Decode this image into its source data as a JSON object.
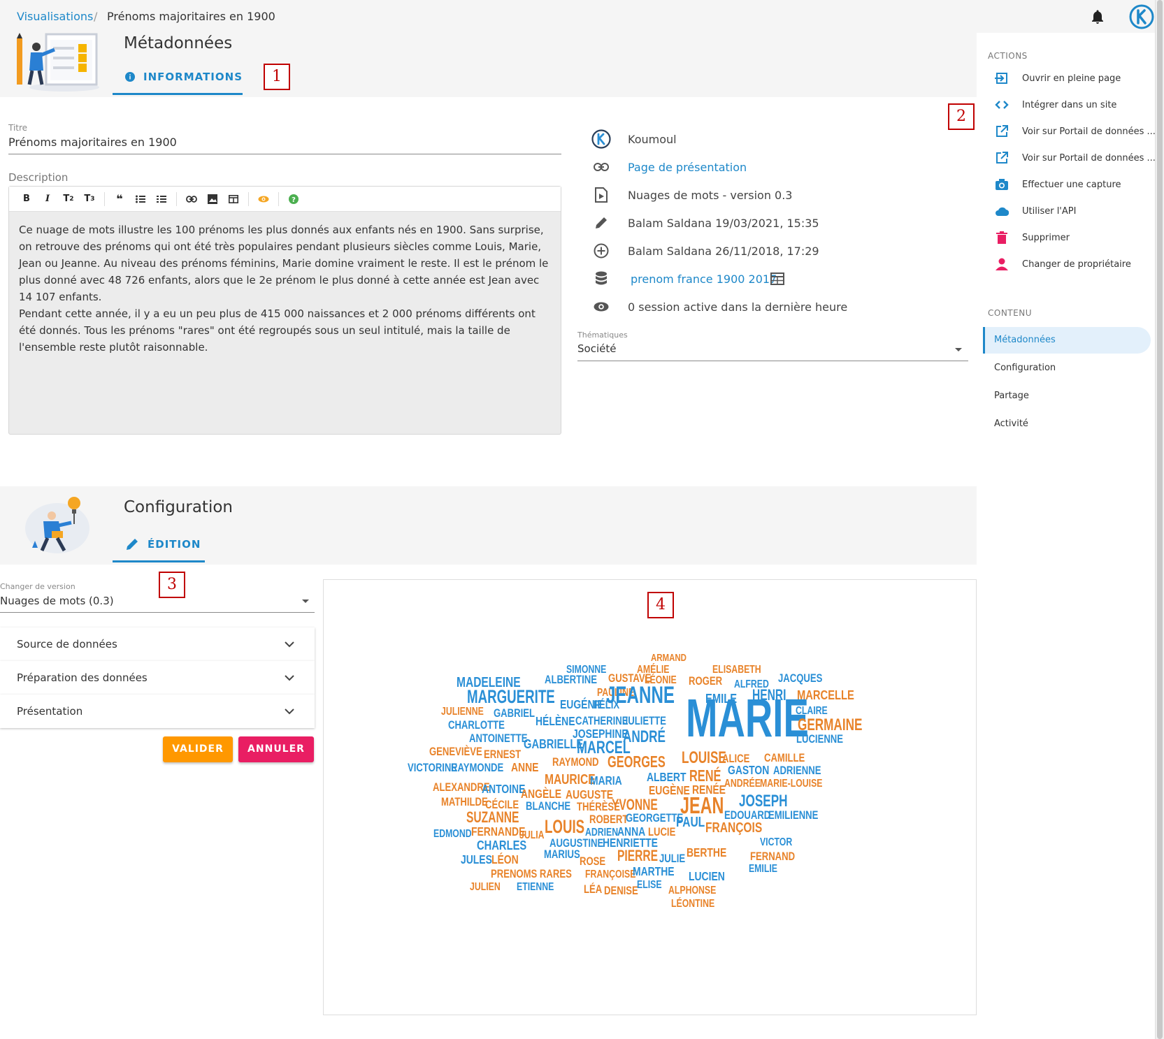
{
  "breadcrumb": {
    "parent": "Visualisations",
    "separator": "/",
    "current": "Prénoms majoritaires en 1900"
  },
  "metadata_section": {
    "title": "Métadonnées",
    "tab_label": "INFORMATIONS",
    "marker_1": "1",
    "marker_2": "2"
  },
  "form": {
    "title_label": "Titre",
    "title_value": "Prénoms majoritaires en 1900",
    "description_label": "Description",
    "toolbar": [
      "B",
      "I",
      "T2",
      "T3",
      "quote",
      "bulleted-list",
      "numbered-list",
      "link",
      "image",
      "table",
      "preview",
      "help"
    ],
    "description_p1": "Ce nuage de mots illustre les 100 prénoms les plus donnés aux enfants nés en 1900. Sans surprise, on retrouve des prénoms qui ont été très populaires pendant plusieurs siècles comme Louis, Marie, Jean ou Jeanne. Au niveau des prénoms féminins, Marie domine vraiment le reste. Il est le prénom le plus donné avec 48 726 enfants, alors que le 2e prénom le plus donné à cette année est Jean avec 14 107 enfants.",
    "description_p2": "Pendant cette année, il y a eu un peu plus de 415 000 naissances et 2 000 prénoms différents ont été donnés. Tous les prénoms \"rares\" ont été regroupés sous un seul intitulé, mais la taille de l'ensemble reste plutôt raisonnable."
  },
  "meta_info": {
    "owner": "Koumoul",
    "presentation_link": "Page de présentation",
    "type": "Nuages de mots - version 0.3",
    "updated": "Balam Saldana 19/03/2021, 15:35",
    "created": "Balam Saldana 26/11/2018, 17:29",
    "dataset": "prenom france 1900 2017",
    "sessions": "0 session active dans la dernière heure",
    "thematics_label": "Thématiques",
    "thematics_value": "Société"
  },
  "side_panel": {
    "actions_heading": "ACTIONS",
    "actions": [
      {
        "label": "Ouvrir en pleine page",
        "icon": "fullscreen-enter-icon",
        "color": "#1e88c9"
      },
      {
        "label": "Intégrer dans un site",
        "icon": "code-icon",
        "color": "#1e88c9"
      },
      {
        "label": "Voir sur Portail de données ...",
        "icon": "open-in-new-icon",
        "color": "#1e88c9"
      },
      {
        "label": "Voir sur Portail de données ...",
        "icon": "open-in-new-icon",
        "color": "#1e88c9"
      },
      {
        "label": "Effectuer une capture",
        "icon": "camera-icon",
        "color": "#1e88c9"
      },
      {
        "label": "Utiliser l'API",
        "icon": "cloud-icon",
        "color": "#1e88c9"
      },
      {
        "label": "Supprimer",
        "icon": "trash-icon",
        "color": "#e91e63"
      },
      {
        "label": "Changer de propriétaire",
        "icon": "person-icon",
        "color": "#e91e63"
      }
    ],
    "content_heading": "CONTENU",
    "content_items": [
      "Métadonnées",
      "Configuration",
      "Partage",
      "Activité"
    ]
  },
  "config_section": {
    "title": "Configuration",
    "tab_label": "ÉDITION",
    "marker_3": "3",
    "marker_4": "4",
    "version_label": "Changer de version",
    "version_value": "Nuages de mots (0.3)",
    "panels": [
      "Source de données",
      "Préparation des données",
      "Présentation"
    ],
    "validate_label": "VALIDER",
    "cancel_label": "ANNULER"
  },
  "colors": {
    "accent": "#1e88c9",
    "orange": "#ff9800",
    "pink": "#e91e63",
    "cloud_blue": "#2a8fd6",
    "cloud_orange": "#e8832a"
  },
  "wordcloud": [
    {
      "t": "ARMAND",
      "c": "o"
    },
    {
      "t": "SIMONNE",
      "c": "b"
    },
    {
      "t": "AMÉLIE",
      "c": "o"
    },
    {
      "t": "ELISABETH",
      "c": "o"
    },
    {
      "t": "MADELEINE",
      "c": "b"
    },
    {
      "t": "ALBERTINE",
      "c": "b"
    },
    {
      "t": "GUSTAVE",
      "c": "o"
    },
    {
      "t": "LÉONIE",
      "c": "o"
    },
    {
      "t": "ROGER",
      "c": "o"
    },
    {
      "t": "ALFRED",
      "c": "b"
    },
    {
      "t": "JACQUES",
      "c": "b"
    },
    {
      "t": "PAULINE",
      "c": "o"
    },
    {
      "t": "MARGUERITE",
      "c": "b"
    },
    {
      "t": "JEANNE",
      "c": "b"
    },
    {
      "t": "EMILE",
      "c": "b"
    },
    {
      "t": "HENRI",
      "c": "b"
    },
    {
      "t": "MARCELLE",
      "c": "o"
    },
    {
      "t": "EUGÉNIE",
      "c": "b"
    },
    {
      "t": "FÉLIX",
      "c": "b"
    },
    {
      "t": "JULIENNE",
      "c": "o"
    },
    {
      "t": "GABRIEL",
      "c": "b"
    },
    {
      "t": "CLAIRE",
      "c": "b"
    },
    {
      "t": "MARIE",
      "c": "b"
    },
    {
      "t": "HÉLÈNE",
      "c": "b"
    },
    {
      "t": "CATHERINE",
      "c": "b"
    },
    {
      "t": "JULIETTE",
      "c": "b"
    },
    {
      "t": "GERMAINE",
      "c": "o"
    },
    {
      "t": "CHARLOTTE",
      "c": "b"
    },
    {
      "t": "JOSEPHINE",
      "c": "b"
    },
    {
      "t": "ANTOINETTE",
      "c": "b"
    },
    {
      "t": "ANDRÉ",
      "c": "b"
    },
    {
      "t": "LUCIENNE",
      "c": "b"
    },
    {
      "t": "GABRIELLE",
      "c": "b"
    },
    {
      "t": "MARCEL",
      "c": "b"
    },
    {
      "t": "GENEVIÈVE",
      "c": "o"
    },
    {
      "t": "ERNEST",
      "c": "o"
    },
    {
      "t": "LOUISE",
      "c": "o"
    },
    {
      "t": "ALICE",
      "c": "o"
    },
    {
      "t": "CAMILLE",
      "c": "o"
    },
    {
      "t": "RAYMOND",
      "c": "o"
    },
    {
      "t": "GEORGES",
      "c": "o"
    },
    {
      "t": "VICTORINE",
      "c": "b"
    },
    {
      "t": "RAYMONDE",
      "c": "b"
    },
    {
      "t": "ANNE",
      "c": "o"
    },
    {
      "t": "GASTON",
      "c": "b"
    },
    {
      "t": "ADRIENNE",
      "c": "b"
    },
    {
      "t": "ALBERT",
      "c": "b"
    },
    {
      "t": "RENÉ",
      "c": "o"
    },
    {
      "t": "MAURICE",
      "c": "o"
    },
    {
      "t": "MARIA",
      "c": "b"
    },
    {
      "t": "ANDRÉE",
      "c": "o"
    },
    {
      "t": "MARIE-LOUISE",
      "c": "o"
    },
    {
      "t": "ALEXANDRE",
      "c": "o"
    },
    {
      "t": "ANTOINE",
      "c": "b"
    },
    {
      "t": "RENÉE",
      "c": "o"
    },
    {
      "t": "EUGÈNE",
      "c": "o"
    },
    {
      "t": "ANGÈLE",
      "c": "o"
    },
    {
      "t": "AUGUSTE",
      "c": "o"
    },
    {
      "t": "JOSEPH",
      "c": "b"
    },
    {
      "t": "MATHILDE",
      "c": "o"
    },
    {
      "t": "CÉCILE",
      "c": "o"
    },
    {
      "t": "BLANCHE",
      "c": "b"
    },
    {
      "t": "THÉRÈSE",
      "c": "o"
    },
    {
      "t": "YVONNE",
      "c": "o"
    },
    {
      "t": "JEAN",
      "c": "o"
    },
    {
      "t": "EDOUARD",
      "c": "b"
    },
    {
      "t": "EMILIENNE",
      "c": "b"
    },
    {
      "t": "SUZANNE",
      "c": "o"
    },
    {
      "t": "ROBERT",
      "c": "o"
    },
    {
      "t": "GEORGETTE",
      "c": "b"
    },
    {
      "t": "PAUL",
      "c": "b"
    },
    {
      "t": "EDMOND",
      "c": "b"
    },
    {
      "t": "FERNANDE",
      "c": "o"
    },
    {
      "t": "JULIA",
      "c": "o"
    },
    {
      "t": "LOUIS",
      "c": "o"
    },
    {
      "t": "ADRIEN",
      "c": "b"
    },
    {
      "t": "ANNA",
      "c": "b"
    },
    {
      "t": "LUCIE",
      "c": "o"
    },
    {
      "t": "FRANÇOIS",
      "c": "o"
    },
    {
      "t": "CHARLES",
      "c": "b"
    },
    {
      "t": "AUGUSTINE",
      "c": "b"
    },
    {
      "t": "HENRIETTE",
      "c": "b"
    },
    {
      "t": "VICTOR",
      "c": "b"
    },
    {
      "t": "JULES",
      "c": "b"
    },
    {
      "t": "LÉON",
      "c": "o"
    },
    {
      "t": "MARIUS",
      "c": "b"
    },
    {
      "t": "ROSE",
      "c": "o"
    },
    {
      "t": "PIERRE",
      "c": "o"
    },
    {
      "t": "JULIE",
      "c": "b"
    },
    {
      "t": "BERTHE",
      "c": "o"
    },
    {
      "t": "FERNAND",
      "c": "o"
    },
    {
      "t": "EMILIE",
      "c": "b"
    },
    {
      "t": "PRENOMS RARES",
      "c": "o"
    },
    {
      "t": "FRANÇOISE",
      "c": "o"
    },
    {
      "t": "MARTHE",
      "c": "b"
    },
    {
      "t": "LUCIEN",
      "c": "b"
    },
    {
      "t": "JULIEN",
      "c": "o"
    },
    {
      "t": "ETIENNE",
      "c": "b"
    },
    {
      "t": "LÉA",
      "c": "o"
    },
    {
      "t": "DENISE",
      "c": "o"
    },
    {
      "t": "ELISE",
      "c": "b"
    },
    {
      "t": "ALPHONSE",
      "c": "o"
    },
    {
      "t": "LÉONTINE",
      "c": "o"
    }
  ]
}
